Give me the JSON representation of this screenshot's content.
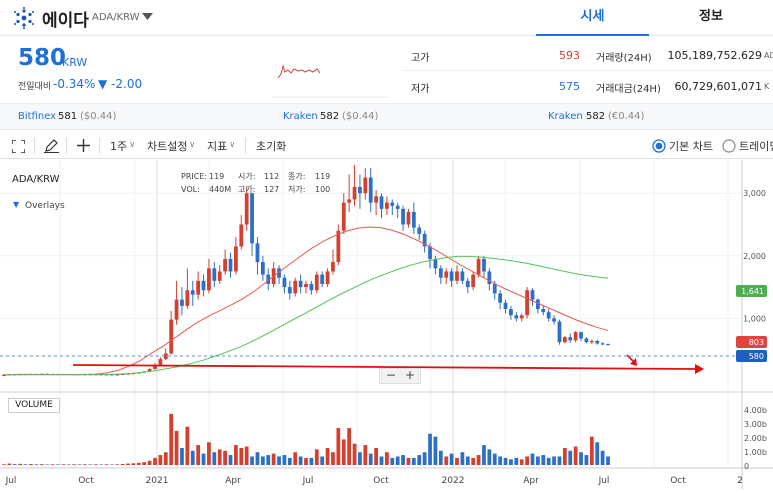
{
  "header": {
    "coin_name": "에이다",
    "pair": "ADA/KRW",
    "tab_price": "시세",
    "tab_info": "정보"
  },
  "summary": {
    "price": "580",
    "currency": "KRW",
    "change_label": "전일대비",
    "change_pct": "-0.34%",
    "change_abs": "▼ -2.00",
    "high_label": "고가",
    "high": "593",
    "low_label": "저가",
    "low": "575",
    "volume_label": "거래량(24H)",
    "volume": "105,189,752.629",
    "volume_unit": "AD",
    "amount_label": "거래대금(24H)",
    "amount": "60,729,601,071",
    "amount_unit": "K"
  },
  "exchanges": [
    {
      "name": "Bitfinex",
      "price": "581",
      "usd": "($0.44)"
    },
    {
      "name": "Kraken",
      "price": "582",
      "usd": "($0.44)"
    },
    {
      "name": "Kraken",
      "price": "582",
      "usd": "(€0.44)"
    }
  ],
  "toolbar": {
    "interval": "1주",
    "chart_settings": "차트설정",
    "indicators": "지표",
    "reset": "초기화",
    "basic_chart": "기본 차트",
    "trading_chart": "트레이딩"
  },
  "chart_info": {
    "symbol": "ADA/KRW",
    "overlays": "Overlays",
    "volume_label": "VOLUME",
    "price_label": "PRICE:",
    "price": "119",
    "vol_label": "VOL:",
    "vol": "440M",
    "open_label": "시가:",
    "open": "112",
    "high_label": "고가:",
    "high": "127",
    "close_label": "종가:",
    "close": "119",
    "low_label": "저가:",
    "low": "100"
  },
  "colors": {
    "up": "#d3402f",
    "down": "#2e6fc6",
    "accent": "#1f6fd6",
    "ma_short": "#e85a4f",
    "ma_long": "#55c455"
  },
  "chart_data": {
    "type": "candlestick",
    "x_ticks": [
      "Jul",
      "Oct",
      "2021",
      "Apr",
      "Jul",
      "Oct",
      "2022",
      "Apr",
      "Jul",
      "Oct",
      "2"
    ],
    "y_ticks": [
      "3,000",
      "2,000",
      "1,000"
    ],
    "volume_ticks": [
      "4.00b",
      "3.00b",
      "2.00b",
      "1.00b",
      "0"
    ],
    "price_labels": {
      "ma_long": "1,641",
      "ma_short": "803",
      "last": "580"
    },
    "candles": [
      {
        "o": 80,
        "c": 100,
        "h": 110,
        "l": 75
      },
      {
        "o": 100,
        "c": 105,
        "h": 115,
        "l": 95
      },
      {
        "o": 105,
        "c": 95,
        "h": 112,
        "l": 90
      },
      {
        "o": 95,
        "c": 110,
        "h": 118,
        "l": 90
      },
      {
        "o": 110,
        "c": 100,
        "h": 115,
        "l": 95
      },
      {
        "o": 100,
        "c": 112,
        "h": 120,
        "l": 96
      },
      {
        "o": 112,
        "c": 105,
        "h": 118,
        "l": 100
      },
      {
        "o": 105,
        "c": 115,
        "h": 122,
        "l": 100
      },
      {
        "o": 115,
        "c": 108,
        "h": 120,
        "l": 102
      },
      {
        "o": 108,
        "c": 112,
        "h": 118,
        "l": 104
      },
      {
        "o": 112,
        "c": 105,
        "h": 116,
        "l": 100
      },
      {
        "o": 105,
        "c": 110,
        "h": 115,
        "l": 100
      },
      {
        "o": 110,
        "c": 104,
        "h": 114,
        "l": 98
      },
      {
        "o": 104,
        "c": 108,
        "h": 113,
        "l": 100
      },
      {
        "o": 108,
        "c": 103,
        "h": 112,
        "l": 98
      },
      {
        "o": 103,
        "c": 107,
        "h": 112,
        "l": 99
      },
      {
        "o": 107,
        "c": 102,
        "h": 110,
        "l": 97
      },
      {
        "o": 102,
        "c": 106,
        "h": 110,
        "l": 98
      },
      {
        "o": 106,
        "c": 101,
        "h": 109,
        "l": 96
      },
      {
        "o": 101,
        "c": 105,
        "h": 109,
        "l": 97
      },
      {
        "o": 105,
        "c": 100,
        "h": 108,
        "l": 95
      },
      {
        "o": 100,
        "c": 104,
        "h": 108,
        "l": 96
      },
      {
        "o": 104,
        "c": 112,
        "h": 117,
        "l": 100
      },
      {
        "o": 112,
        "c": 119,
        "h": 127,
        "l": 100
      },
      {
        "o": 119,
        "c": 125,
        "h": 135,
        "l": 112
      },
      {
        "o": 125,
        "c": 135,
        "h": 142,
        "l": 118
      },
      {
        "o": 135,
        "c": 150,
        "h": 158,
        "l": 128
      },
      {
        "o": 150,
        "c": 190,
        "h": 205,
        "l": 145
      },
      {
        "o": 190,
        "c": 260,
        "h": 290,
        "l": 180
      },
      {
        "o": 260,
        "c": 350,
        "h": 380,
        "l": 250
      },
      {
        "o": 350,
        "c": 440,
        "h": 520,
        "l": 330
      },
      {
        "o": 440,
        "c": 980,
        "h": 1120,
        "l": 420
      },
      {
        "o": 980,
        "c": 1300,
        "h": 1600,
        "l": 900
      },
      {
        "o": 1300,
        "c": 1200,
        "h": 1500,
        "l": 1050
      },
      {
        "o": 1200,
        "c": 1450,
        "h": 1800,
        "l": 1150
      },
      {
        "o": 1450,
        "c": 1380,
        "h": 1600,
        "l": 1200
      },
      {
        "o": 1380,
        "c": 1600,
        "h": 1750,
        "l": 1300
      },
      {
        "o": 1600,
        "c": 1450,
        "h": 1700,
        "l": 1350
      },
      {
        "o": 1450,
        "c": 1800,
        "h": 1950,
        "l": 1400
      },
      {
        "o": 1800,
        "c": 1600,
        "h": 1900,
        "l": 1500
      },
      {
        "o": 1600,
        "c": 1750,
        "h": 1850,
        "l": 1550
      },
      {
        "o": 1750,
        "c": 1950,
        "h": 2100,
        "l": 1700
      },
      {
        "o": 1950,
        "c": 1750,
        "h": 2050,
        "l": 1650
      },
      {
        "o": 1750,
        "c": 2150,
        "h": 2300,
        "l": 1700
      },
      {
        "o": 2150,
        "c": 2500,
        "h": 2650,
        "l": 2100
      },
      {
        "o": 2500,
        "c": 3000,
        "h": 3100,
        "l": 2400
      },
      {
        "o": 3000,
        "c": 2200,
        "h": 3000,
        "l": 2000
      },
      {
        "o": 2200,
        "c": 1900,
        "h": 2300,
        "l": 1700
      },
      {
        "o": 1900,
        "c": 1700,
        "h": 2000,
        "l": 1600
      },
      {
        "o": 1700,
        "c": 1550,
        "h": 1800,
        "l": 1450
      },
      {
        "o": 1550,
        "c": 1800,
        "h": 1900,
        "l": 1500
      },
      {
        "o": 1800,
        "c": 1650,
        "h": 1850,
        "l": 1550
      },
      {
        "o": 1650,
        "c": 1500,
        "h": 1700,
        "l": 1400
      },
      {
        "o": 1500,
        "c": 1400,
        "h": 1600,
        "l": 1300
      },
      {
        "o": 1400,
        "c": 1600,
        "h": 1650,
        "l": 1350
      },
      {
        "o": 1600,
        "c": 1500,
        "h": 1700,
        "l": 1400
      },
      {
        "o": 1500,
        "c": 1550,
        "h": 1600,
        "l": 1400
      },
      {
        "o": 1550,
        "c": 1450,
        "h": 1600,
        "l": 1380
      },
      {
        "o": 1450,
        "c": 1700,
        "h": 1750,
        "l": 1400
      },
      {
        "o": 1700,
        "c": 1550,
        "h": 1750,
        "l": 1500
      },
      {
        "o": 1550,
        "c": 1750,
        "h": 1800,
        "l": 1500
      },
      {
        "o": 1750,
        "c": 1900,
        "h": 2100,
        "l": 1700
      },
      {
        "o": 1900,
        "c": 2400,
        "h": 2500,
        "l": 1850
      },
      {
        "o": 2400,
        "c": 2850,
        "h": 3000,
        "l": 2350
      },
      {
        "o": 2850,
        "c": 2900,
        "h": 3300,
        "l": 2700
      },
      {
        "o": 2900,
        "c": 3100,
        "h": 3450,
        "l": 2800
      },
      {
        "o": 3100,
        "c": 3000,
        "h": 3300,
        "l": 2750
      },
      {
        "o": 3000,
        "c": 3250,
        "h": 3400,
        "l": 2900
      },
      {
        "o": 3250,
        "c": 2850,
        "h": 3400,
        "l": 2700
      },
      {
        "o": 2850,
        "c": 2950,
        "h": 3050,
        "l": 2650
      },
      {
        "o": 2950,
        "c": 2750,
        "h": 3000,
        "l": 2600
      },
      {
        "o": 2750,
        "c": 2850,
        "h": 2950,
        "l": 2650
      },
      {
        "o": 2850,
        "c": 2800,
        "h": 2900,
        "l": 2650
      },
      {
        "o": 2800,
        "c": 2750,
        "h": 2850,
        "l": 2600
      },
      {
        "o": 2750,
        "c": 2500,
        "h": 2800,
        "l": 2400
      },
      {
        "o": 2500,
        "c": 2700,
        "h": 2750,
        "l": 2450
      },
      {
        "o": 2700,
        "c": 2450,
        "h": 2850,
        "l": 2350
      },
      {
        "o": 2450,
        "c": 2350,
        "h": 2500,
        "l": 2250
      },
      {
        "o": 2350,
        "c": 2150,
        "h": 2400,
        "l": 2050
      },
      {
        "o": 2150,
        "c": 1950,
        "h": 2200,
        "l": 1800
      },
      {
        "o": 1950,
        "c": 1800,
        "h": 2000,
        "l": 1700
      },
      {
        "o": 1800,
        "c": 1650,
        "h": 1850,
        "l": 1550
      },
      {
        "o": 1650,
        "c": 1750,
        "h": 1800,
        "l": 1550
      },
      {
        "o": 1750,
        "c": 1600,
        "h": 1800,
        "l": 1500
      },
      {
        "o": 1600,
        "c": 1750,
        "h": 1850,
        "l": 1550
      },
      {
        "o": 1750,
        "c": 1600,
        "h": 1800,
        "l": 1550
      },
      {
        "o": 1600,
        "c": 1500,
        "h": 1650,
        "l": 1400
      },
      {
        "o": 1500,
        "c": 1700,
        "h": 1750,
        "l": 1450
      },
      {
        "o": 1700,
        "c": 1950,
        "h": 2000,
        "l": 1650
      },
      {
        "o": 1950,
        "c": 1750,
        "h": 2000,
        "l": 1650
      },
      {
        "o": 1750,
        "c": 1550,
        "h": 1800,
        "l": 1450
      },
      {
        "o": 1550,
        "c": 1400,
        "h": 1600,
        "l": 1300
      },
      {
        "o": 1400,
        "c": 1250,
        "h": 1450,
        "l": 1150
      },
      {
        "o": 1250,
        "c": 1150,
        "h": 1300,
        "l": 1080
      },
      {
        "o": 1150,
        "c": 1050,
        "h": 1200,
        "l": 980
      },
      {
        "o": 1050,
        "c": 1000,
        "h": 1100,
        "l": 950
      },
      {
        "o": 1000,
        "c": 1050,
        "h": 1080,
        "l": 950
      },
      {
        "o": 1050,
        "c": 1450,
        "h": 1500,
        "l": 1000
      },
      {
        "o": 1450,
        "c": 1300,
        "h": 1480,
        "l": 1200
      },
      {
        "o": 1300,
        "c": 1150,
        "h": 1320,
        "l": 1080
      },
      {
        "o": 1150,
        "c": 1100,
        "h": 1200,
        "l": 1050
      },
      {
        "o": 1100,
        "c": 1000,
        "h": 1150,
        "l": 950
      },
      {
        "o": 1000,
        "c": 950,
        "h": 1050,
        "l": 900
      },
      {
        "o": 950,
        "c": 620,
        "h": 980,
        "l": 580
      },
      {
        "o": 620,
        "c": 700,
        "h": 720,
        "l": 600
      },
      {
        "o": 700,
        "c": 650,
        "h": 760,
        "l": 610
      },
      {
        "o": 650,
        "c": 780,
        "h": 800,
        "l": 620
      },
      {
        "o": 780,
        "c": 680,
        "h": 790,
        "l": 640
      },
      {
        "o": 680,
        "c": 620,
        "h": 700,
        "l": 600
      },
      {
        "o": 620,
        "c": 640,
        "h": 660,
        "l": 590
      },
      {
        "o": 640,
        "c": 600,
        "h": 660,
        "l": 580
      },
      {
        "o": 600,
        "c": 590,
        "h": 620,
        "l": 570
      },
      {
        "o": 590,
        "c": 580,
        "h": 600,
        "l": 570
      }
    ],
    "ma_short": [
      100,
      105,
      106,
      104,
      103,
      104,
      104,
      106,
      110,
      130,
      170,
      240,
      330,
      450,
      560,
      690,
      820,
      940,
      1040,
      1130,
      1220,
      1320,
      1440,
      1580,
      1720,
      1860,
      1990,
      2120,
      2230,
      2320,
      2390,
      2440,
      2460,
      2450,
      2410,
      2350,
      2270,
      2180,
      2080,
      1970,
      1860,
      1760,
      1660,
      1560,
      1470,
      1390,
      1310,
      1230,
      1150,
      1070,
      990,
      920,
      860,
      803
    ],
    "ma_long": [
      100,
      100,
      100,
      100,
      100,
      101,
      101,
      102,
      103,
      106,
      112,
      122,
      140,
      165,
      195,
      230,
      275,
      325,
      385,
      450,
      520,
      600,
      690,
      790,
      890,
      990,
      1090,
      1190,
      1290,
      1390,
      1480,
      1570,
      1650,
      1720,
      1790,
      1850,
      1900,
      1940,
      1970,
      1990,
      1990,
      1980,
      1960,
      1940,
      1910,
      1880,
      1840,
      1800,
      1760,
      1720,
      1690,
      1665,
      1641
    ]
  }
}
